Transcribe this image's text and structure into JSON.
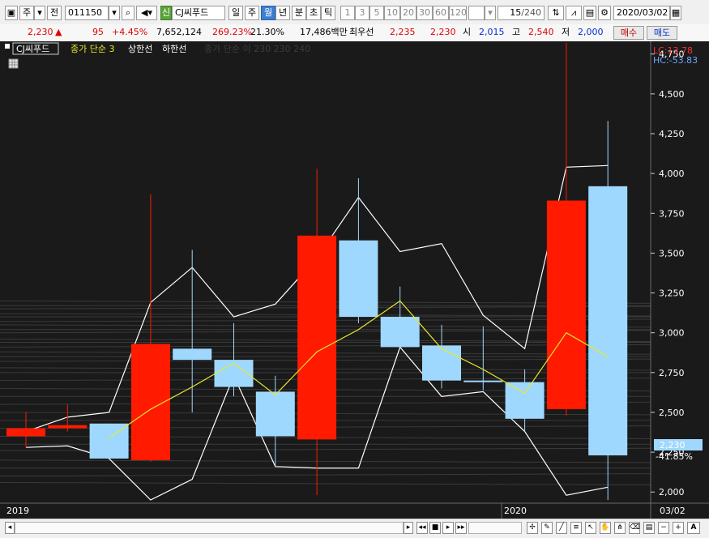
{
  "toolbar": {
    "type_label": "주",
    "prev_label": "전",
    "code": "011150",
    "badge": "신",
    "name": "CJ씨푸드",
    "periods": [
      "일",
      "주",
      "월",
      "년"
    ],
    "selected_period": "월",
    "intervals": [
      "분",
      "초",
      "틱"
    ],
    "numbers": [
      "1",
      "3",
      "5",
      "10",
      "20",
      "30",
      "60",
      "120"
    ],
    "count_display": "15",
    "count_total": "/240",
    "date": "2020/03/02"
  },
  "quote": {
    "price": "2,230",
    "change_arrow": "▲",
    "change": "95",
    "change_pct": "+4.45%",
    "volume": "7,652,124",
    "volume_ratio": "269.23%",
    "turnover": "21.30%",
    "amount": "17,486백만",
    "best_ask_label": "최우선",
    "best_ask": "2,235",
    "best_bid": "2,230",
    "open_label": "시",
    "open": "2,015",
    "high_label": "고",
    "high": "2,540",
    "low_label": "저",
    "low": "2,000",
    "buy_label": "매수",
    "sell_label": "매도"
  },
  "legend": {
    "name": "CJ씨푸드",
    "ma": "종가 단순 3",
    "upper": "상한선",
    "lower": "하한선",
    "hidden": "종가 단순 이  230  230  240"
  },
  "right_info": {
    "lc": "LC:13.78",
    "hc": "HC:-53.83"
  },
  "price_tag": {
    "value": "2,230",
    "pct": "-41.85%"
  },
  "axis": {
    "ticks": [
      {
        "value": 2000,
        "label": "2,000"
      },
      {
        "value": 2250,
        "label": "2,250"
      },
      {
        "value": 2500,
        "label": "2,500"
      },
      {
        "value": 2750,
        "label": "2,750"
      },
      {
        "value": 3000,
        "label": "3,000"
      },
      {
        "value": 3250,
        "label": "3,250"
      },
      {
        "value": 3500,
        "label": "3,500"
      },
      {
        "value": 3750,
        "label": "3,750"
      },
      {
        "value": 4000,
        "label": "4,000"
      },
      {
        "value": 4250,
        "label": "4,250"
      },
      {
        "value": 4500,
        "label": "4,500"
      },
      {
        "value": 4750,
        "label": "4,750"
      }
    ],
    "x_labels": [
      "2019",
      "2020"
    ],
    "date_end": "03/02"
  },
  "chart_data": {
    "type": "candlestick",
    "ymin": 1930,
    "ymax": 4830,
    "candles": [
      {
        "o": 2350,
        "h": 2500,
        "l": 2280,
        "c": 2400
      },
      {
        "o": 2400,
        "h": 2550,
        "l": 2380,
        "c": 2420
      },
      {
        "o": 2430,
        "h": 2430,
        "l": 2220,
        "c": 2210
      },
      {
        "o": 2200,
        "h": 3870,
        "l": 2190,
        "c": 2930
      },
      {
        "o": 2900,
        "h": 3520,
        "l": 2500,
        "c": 2830
      },
      {
        "o": 2830,
        "h": 3060,
        "l": 2600,
        "c": 2660
      },
      {
        "o": 2630,
        "h": 2730,
        "l": 2160,
        "c": 2350
      },
      {
        "o": 2330,
        "h": 4030,
        "l": 1980,
        "c": 3610
      },
      {
        "o": 3580,
        "h": 3970,
        "l": 3060,
        "c": 3100
      },
      {
        "o": 3100,
        "h": 3290,
        "l": 2910,
        "c": 2910
      },
      {
        "o": 2920,
        "h": 3050,
        "l": 2650,
        "c": 2700
      },
      {
        "o": 2700,
        "h": 3040,
        "l": 2640,
        "c": 2690
      },
      {
        "o": 2690,
        "h": 2770,
        "l": 2380,
        "c": 2460
      },
      {
        "o": 2520,
        "h": 4820,
        "l": 2480,
        "c": 3830
      },
      {
        "o": 3920,
        "h": 4330,
        "l": 1950,
        "c": 2230
      }
    ],
    "ma3": [
      null,
      null,
      2340,
      2520,
      2660,
      2810,
      2610,
      2880,
      3020,
      3200,
      2900,
      2770,
      2620,
      3000,
      2850
    ],
    "upper_band": [
      2380,
      2470,
      2500,
      3190,
      3410,
      3100,
      3180,
      3470,
      3850,
      3510,
      3560,
      3110,
      2900,
      4040,
      4050
    ],
    "lower_band": [
      2280,
      2290,
      2210,
      1950,
      2080,
      2730,
      2160,
      2150,
      2150,
      2910,
      2600,
      2630,
      2380,
      1980,
      2030
    ],
    "background_lines": [
      3200,
      3170,
      3150,
      3120,
      3100,
      3070,
      3050,
      3020,
      3000,
      2960,
      2940,
      2910,
      2880,
      2850,
      2820,
      2780,
      2750,
      2700,
      2650,
      2600,
      2550,
      2500,
      2450,
      2400,
      2350,
      2300,
      2260,
      2200,
      2150,
      2100,
      2060
    ]
  },
  "colors": {
    "up": "#ff1a00",
    "down": "#9fd8ff",
    "ma": "#e8e82a",
    "band": "#ffffff",
    "bg": "#1a1a1a"
  }
}
